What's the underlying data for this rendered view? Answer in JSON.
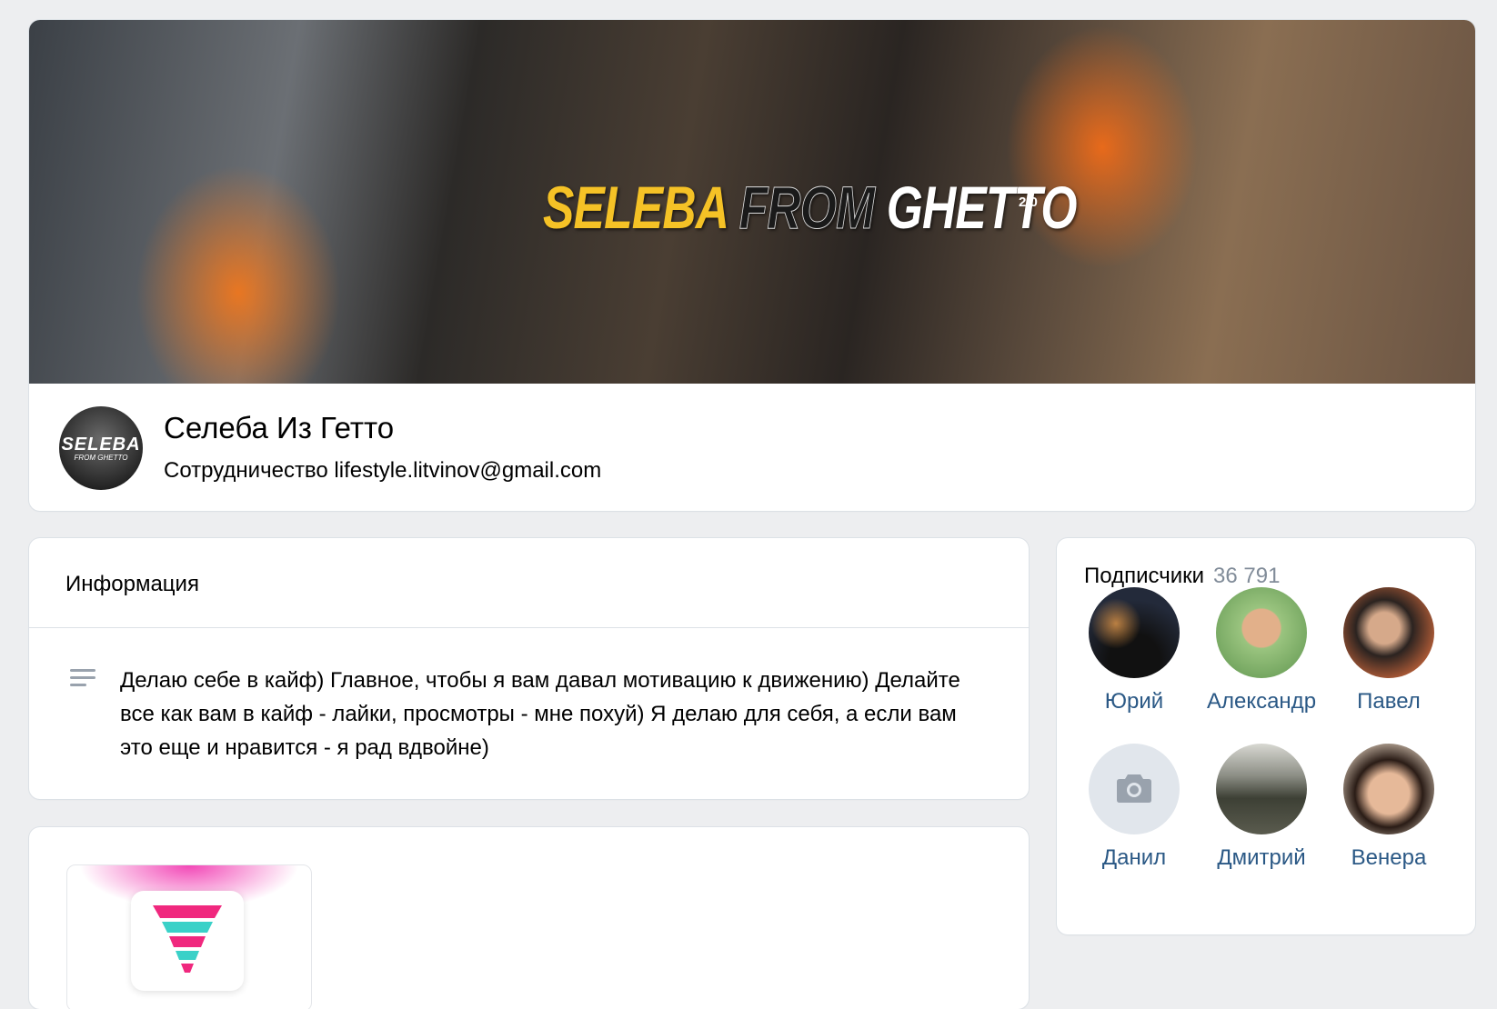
{
  "header": {
    "cover_title_1": "SELEBA",
    "cover_title_2": "FROM",
    "cover_title_3": "GHETTO",
    "cover_version": "2.0",
    "avatar_line1": "SELEBA",
    "avatar_line2": "FROM GHETTO",
    "group_name": "Селеба Из Гетто",
    "status": "Сотрудничество lifestyle.litvinov@gmail.com"
  },
  "info": {
    "title": "Информация",
    "description": "Делаю себе в кайф) Главное, чтобы я вам давал мотивацию к движению) Делайте все как вам в кайф - лайки, просмотры - мне похуй) Я делаю для себя, а если вам это еще и нравится - я рад вдвойне)"
  },
  "subscribers": {
    "title": "Подписчики",
    "count": "36 791",
    "items": [
      {
        "name": "Юрий",
        "color": "#1c2230"
      },
      {
        "name": "Александр",
        "color": "#7fb36a"
      },
      {
        "name": "Павел",
        "color": "#c46a3e"
      },
      {
        "name": "Данил",
        "color": "#e1e6ec"
      },
      {
        "name": "Дмитрий",
        "color": "#4a4d43"
      },
      {
        "name": "Венера",
        "color": "#d9b9a0"
      }
    ]
  },
  "icons": {
    "description": "text-lines-icon",
    "camera": "camera-icon",
    "app": "funnel-logo-icon"
  },
  "colors": {
    "background": "#edeef0",
    "link": "#2a5885",
    "muted": "#818c99",
    "accent_yellow": "#f5c226"
  }
}
